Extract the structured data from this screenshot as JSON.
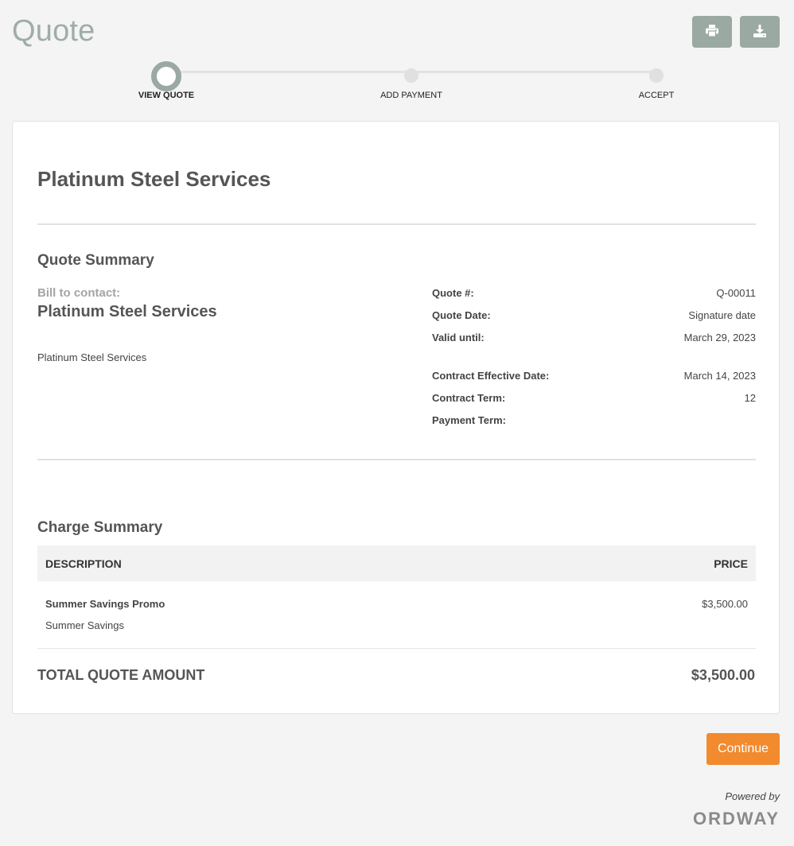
{
  "header": {
    "title": "Quote",
    "print_icon": "print-icon",
    "download_icon": "download-icon"
  },
  "stepper": {
    "steps": [
      {
        "label": "VIEW QUOTE",
        "state": "active"
      },
      {
        "label": "ADD PAYMENT",
        "state": "pending"
      },
      {
        "label": "ACCEPT",
        "state": "pending"
      }
    ]
  },
  "quote": {
    "company": "Platinum Steel Services",
    "summary_title": "Quote Summary",
    "bill_to_label": "Bill to contact:",
    "bill_to_name": "Platinum Steel Services",
    "bill_to_address": "Platinum Steel Services",
    "meta": [
      {
        "label": "Quote #:",
        "value": "Q-00011"
      },
      {
        "label": "Quote Date:",
        "value": "Signature date"
      },
      {
        "label": "Valid until:",
        "value": "March 29, 2023"
      },
      {
        "label": "Contract Effective Date:",
        "value": "March 14, 2023"
      },
      {
        "label": "Contract Term:",
        "value": "12"
      },
      {
        "label": "Payment Term:",
        "value": ""
      }
    ]
  },
  "charges": {
    "title": "Charge Summary",
    "columns": {
      "description": "DESCRIPTION",
      "price": "PRICE"
    },
    "rows": [
      {
        "name": "Summer Savings Promo",
        "sub": "Summer Savings",
        "price": "$3,500.00"
      }
    ],
    "total_label": "TOTAL QUOTE AMOUNT",
    "total_value": "$3,500.00"
  },
  "actions": {
    "continue_label": "Continue"
  },
  "footer": {
    "powered_by": "Powered by",
    "brand": "ORDWAY"
  },
  "colors": {
    "accent": "#f28a2e",
    "step_active": "#9aa9a2",
    "title_gray": "#9fada6"
  }
}
